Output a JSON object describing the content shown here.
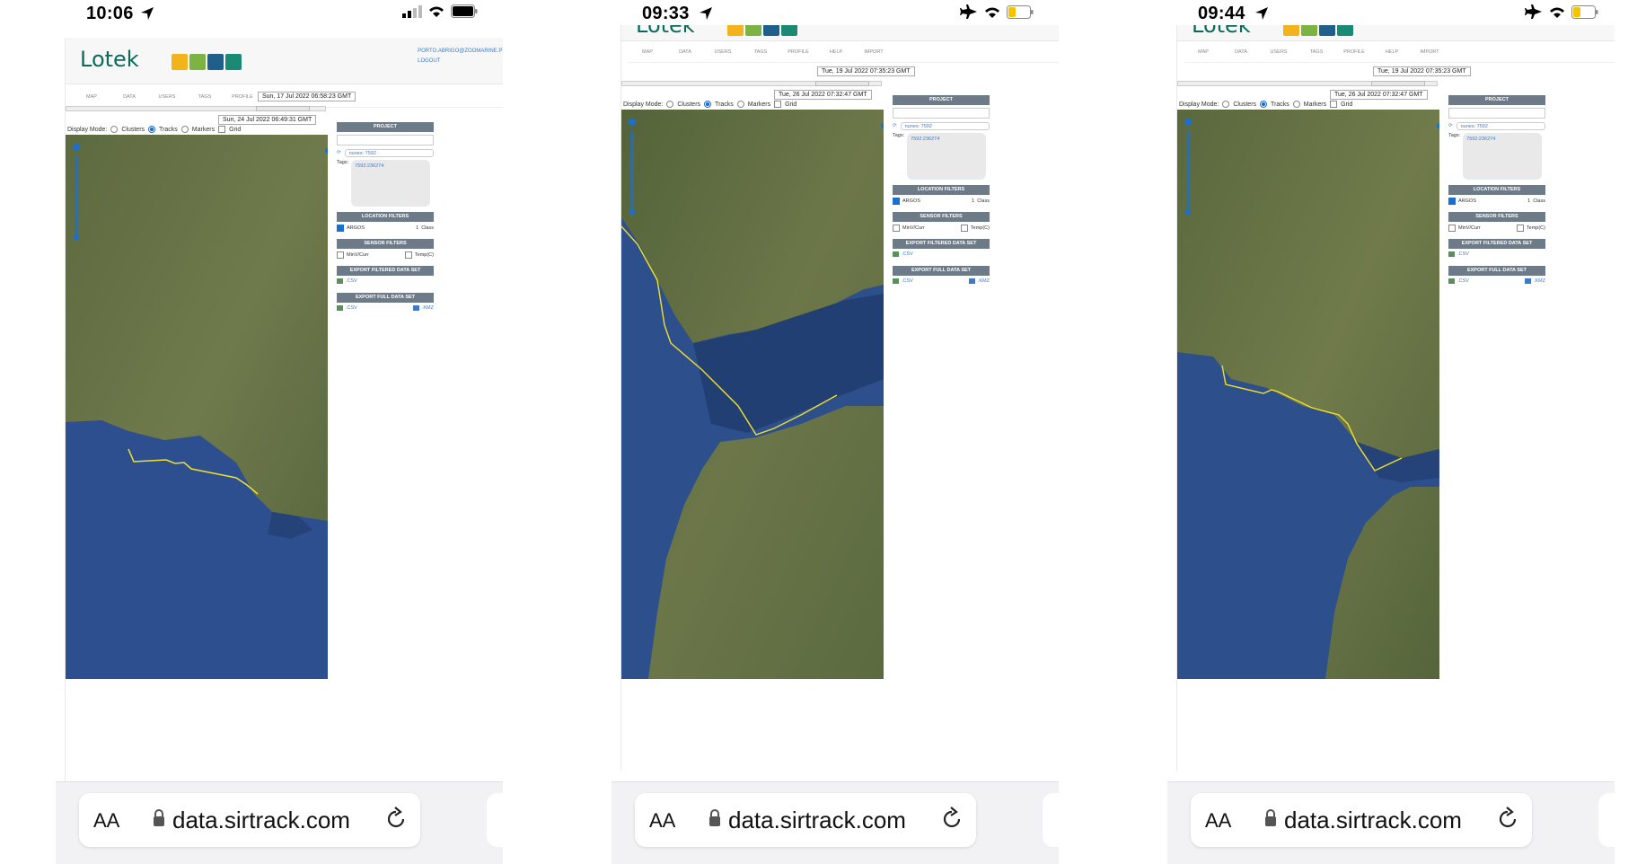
{
  "screens": [
    {
      "status": {
        "time": "10:06",
        "mode": "cellular"
      },
      "header": {
        "logo": "Lotek",
        "user_email": "PORTO.ABRIGO@ZOOMARINE.PT",
        "logout": "LOGOUT"
      },
      "nav": [
        "MAP",
        "DATA",
        "USERS",
        "TAGS",
        "PROFILE",
        "HELP",
        "IMPORT"
      ],
      "range": {
        "start": "Sun, 17 Jul 2022 06:58:23 GMT",
        "end": "Sun, 24 Jul 2022 06:49:31 GMT"
      },
      "display_mode": {
        "label": "Display Mode:",
        "options": [
          "Clusters",
          "Tracks",
          "Markers",
          "Grid"
        ],
        "selected": "Tracks"
      },
      "panel": {
        "project_title": "PROJECT",
        "project_value": "nunes: 7592",
        "tags_label": "Tags:",
        "tag_value": "7592:236274",
        "location_filters": "LOCATION FILTERS",
        "argos": "ARGOS",
        "class_value": "1",
        "class_label": "Class",
        "sensor_filters": "SENSOR FILTERS",
        "sensor_1": "MinV/Curr",
        "sensor_2": "Temp(C)",
        "export_filtered": "EXPORT FILTERED DATA SET",
        "export_filtered_csv": ".CSV",
        "export_full": "EXPORT FULL DATA SET",
        "export_full_csv": ".CSV",
        "export_full_kmz": ".KMZ"
      },
      "url": {
        "aa": "AA",
        "domain": "data.sirtrack.com"
      }
    },
    {
      "status": {
        "time": "09:33",
        "mode": "airplane"
      },
      "header": {
        "logo": "Lotek"
      },
      "nav": [
        "MAP",
        "DATA",
        "USERS",
        "TAGS",
        "PROFILE",
        "HELP",
        "IMPORT"
      ],
      "range": {
        "start": "Tue, 19 Jul 2022 07:35:23 GMT",
        "end": "Tue, 26 Jul 2022 07:32:47 GMT"
      },
      "display_mode": {
        "label": "Display Mode:",
        "options": [
          "Clusters",
          "Tracks",
          "Markers",
          "Grid"
        ],
        "selected": "Tracks"
      },
      "panel": {
        "project_title": "PROJECT",
        "project_value": "nunes: 7592",
        "tags_label": "Tags:",
        "tag_value": "7592:236274",
        "location_filters": "LOCATION FILTERS",
        "argos": "ARGOS",
        "class_value": "1",
        "class_label": "Class",
        "sensor_filters": "SENSOR FILTERS",
        "sensor_1": "MinV/Curr",
        "sensor_2": "Temp(C)",
        "export_filtered": "EXPORT FILTERED DATA SET",
        "export_filtered_csv": ".CSV",
        "export_full": "EXPORT FULL DATA SET",
        "export_full_csv": ".CSV",
        "export_full_kmz": ".KMZ"
      },
      "url": {
        "aa": "AA",
        "domain": "data.sirtrack.com"
      }
    },
    {
      "status": {
        "time": "09:44",
        "mode": "airplane"
      },
      "header": {
        "logo": "Lotek"
      },
      "nav": [
        "MAP",
        "DATA",
        "USERS",
        "TAGS",
        "PROFILE",
        "HELP",
        "IMPORT"
      ],
      "range": {
        "start": "Tue, 19 Jul 2022 07:35:23 GMT",
        "end": "Tue, 26 Jul 2022 07:32:47 GMT"
      },
      "display_mode": {
        "label": "Display Mode:",
        "options": [
          "Clusters",
          "Tracks",
          "Markers",
          "Grid"
        ],
        "selected": "Tracks"
      },
      "panel": {
        "project_title": "PROJECT",
        "project_value": "nunes: 7592",
        "tags_label": "Tags:",
        "tag_value": "7592:236274",
        "location_filters": "LOCATION FILTERS",
        "argos": "ARGOS",
        "class_value": "1",
        "class_label": "Class",
        "sensor_filters": "SENSOR FILTERS",
        "sensor_1": "MinV/Curr",
        "sensor_2": "Temp(C)",
        "export_filtered": "EXPORT FILTERED DATA SET",
        "export_filtered_csv": ".CSV",
        "export_full": "EXPORT FULL DATA SET",
        "export_full_csv": ".CSV",
        "export_full_kmz": ".KMZ"
      },
      "url": {
        "aa": "AA",
        "domain": "data.sirtrack.com"
      }
    }
  ],
  "colors": {
    "accent": "#1a6fd1",
    "track": "#f2e12a",
    "brand": "#0b6a5a",
    "panel_head": "#6d7b88",
    "sea": "#2d4f8c",
    "land": "#5f6e45"
  }
}
